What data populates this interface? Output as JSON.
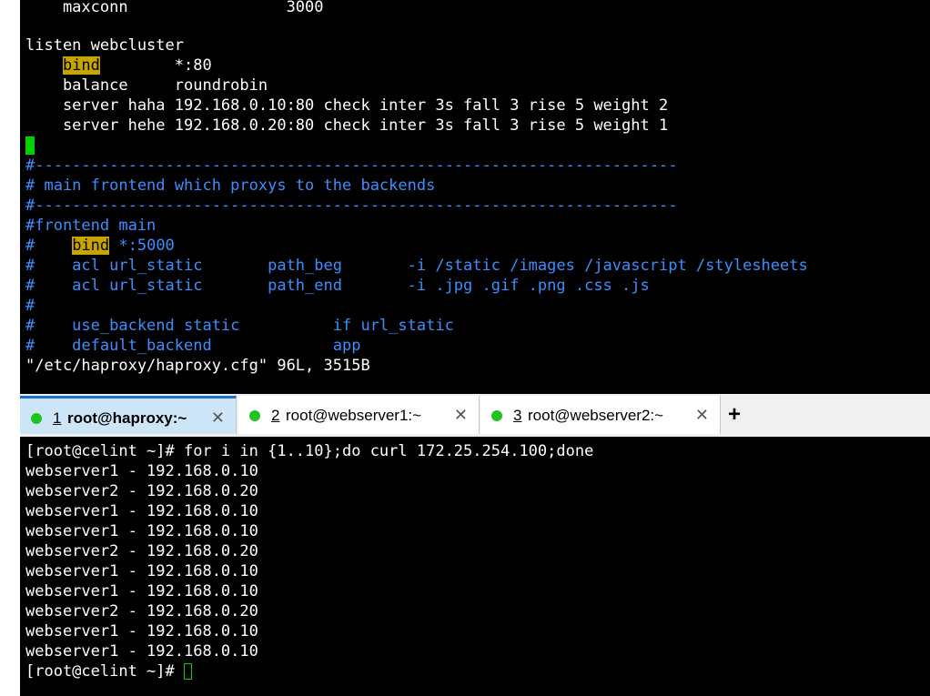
{
  "colors": {
    "background": "#000000",
    "text": "#ffffff",
    "comment": "#3c8fff",
    "highlight": "#c7a500",
    "cursor": "#00d000",
    "active_tab": "#cde6f7",
    "status_dot": "#22c422"
  },
  "editor": {
    "lines": [
      {
        "pre": "    maxconn                 3000"
      },
      {
        "pre": ""
      },
      {
        "pre": "listen webcluster"
      },
      {
        "pre": "    ",
        "hl": "bind",
        "post": "        *:80"
      },
      {
        "pre": "    balance     roundrobin"
      },
      {
        "pre": "    server haha 192.168.0.10:80 check inter 3s fall 3 rise 5 weight 2"
      },
      {
        "pre": "    server hehe 192.168.0.20:80 check inter 3s fall 3 rise 5 weight 1"
      },
      {
        "pre": ""
      },
      {
        "pre": "#---------------------------------------------------------------------",
        "comment": true
      },
      {
        "pre": "# main frontend which proxys to the backends",
        "comment": true
      },
      {
        "pre": "#---------------------------------------------------------------------",
        "comment": true
      },
      {
        "pre": "#frontend main",
        "comment": true
      },
      {
        "pre": "#    ",
        "hl": "bind",
        "post": " *:5000",
        "comment": true
      },
      {
        "pre": "#    acl url_static       path_beg       -i /static /images /javascript /stylesheets",
        "comment": true
      },
      {
        "pre": "#    acl url_static       path_end       -i .jpg .gif .png .css .js",
        "comment": true
      },
      {
        "pre": "#",
        "comment": true
      },
      {
        "pre": "#    use_backend static          if url_static",
        "comment": true
      },
      {
        "pre": "#    default_backend             app",
        "comment": true
      },
      {
        "pre": "\"/etc/haproxy/haproxy.cfg\" 96L, 3515B"
      }
    ]
  },
  "tabs": [
    {
      "num": "1",
      "label": "root@haproxy:~",
      "close": "✕"
    },
    {
      "num": "2",
      "label": "root@webserver1:~",
      "close": "✕"
    },
    {
      "num": "3",
      "label": "root@webserver2:~",
      "close": "✕"
    }
  ],
  "new_tab_label": "+",
  "shell": {
    "command": "[root@celint ~]# for i in {1..10};do curl 172.25.254.100;done",
    "output": [
      "webserver1 - 192.168.0.10",
      "webserver2 - 192.168.0.20",
      "webserver1 - 192.168.0.10",
      "webserver1 - 192.168.0.10",
      "webserver2 - 192.168.0.20",
      "webserver1 - 192.168.0.10",
      "webserver1 - 192.168.0.10",
      "webserver2 - 192.168.0.20",
      "webserver1 - 192.168.0.10",
      "webserver1 - 192.168.0.10"
    ],
    "prompt": "[root@celint ~]# "
  }
}
